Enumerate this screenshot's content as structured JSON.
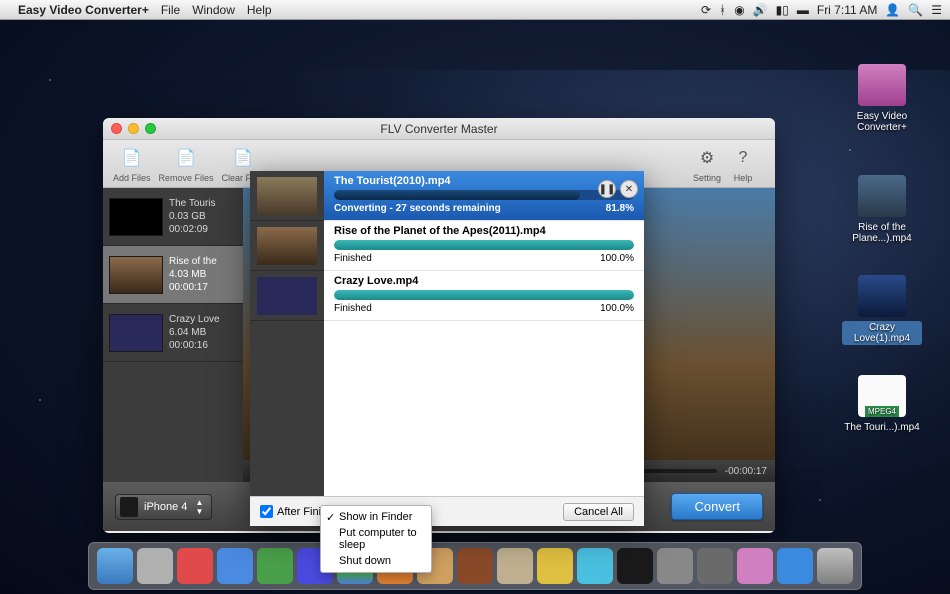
{
  "menubar": {
    "app_name": "Easy Video Converter+",
    "items": [
      "File",
      "Window",
      "Help"
    ],
    "clock": "Fri 7:11 AM"
  },
  "desktop": {
    "icons": [
      {
        "label": "Easy Video Converter+"
      },
      {
        "label": "Rise of the Plane...).mp4"
      },
      {
        "label": "Crazy Love(1).mp4"
      },
      {
        "label": "The Touri...).mp4"
      }
    ]
  },
  "window": {
    "title": "FLV Converter Master",
    "toolbar": {
      "add": "Add Files",
      "remove": "Remove Files",
      "clear": "Clear Files",
      "setting": "Setting",
      "help": "Help"
    },
    "sidebar": [
      {
        "title": "The Touris",
        "size": "0.03 GB",
        "dur": "00:02:09"
      },
      {
        "title": "Rise of the",
        "size": "4.03 MB",
        "dur": "00:00:17"
      },
      {
        "title": "Crazy Love",
        "size": "6.04 MB",
        "dur": "00:00:16"
      }
    ],
    "preview_time": "-00:00:17",
    "device": "iPhone 4",
    "convert": "Convert"
  },
  "progress": {
    "items": [
      {
        "name": "The Tourist(2010).mp4",
        "status": "Converting - 27 seconds remaining",
        "pct": "81.8%",
        "fill": 82,
        "active": true
      },
      {
        "name": "Rise of the Planet of the Apes(2011).mp4",
        "status": "Finished",
        "pct": "100.0%",
        "fill": 100,
        "active": false
      },
      {
        "name": "Crazy Love.mp4",
        "status": "Finished",
        "pct": "100.0%",
        "fill": 100,
        "active": false
      }
    ],
    "after_label": "After Finish",
    "cancel_all": "Cancel All"
  },
  "dropdown": {
    "items": [
      {
        "label": "Show in Finder",
        "checked": true
      },
      {
        "label": "Put computer to sleep",
        "checked": false
      },
      {
        "label": "Shut down",
        "checked": false
      }
    ]
  }
}
